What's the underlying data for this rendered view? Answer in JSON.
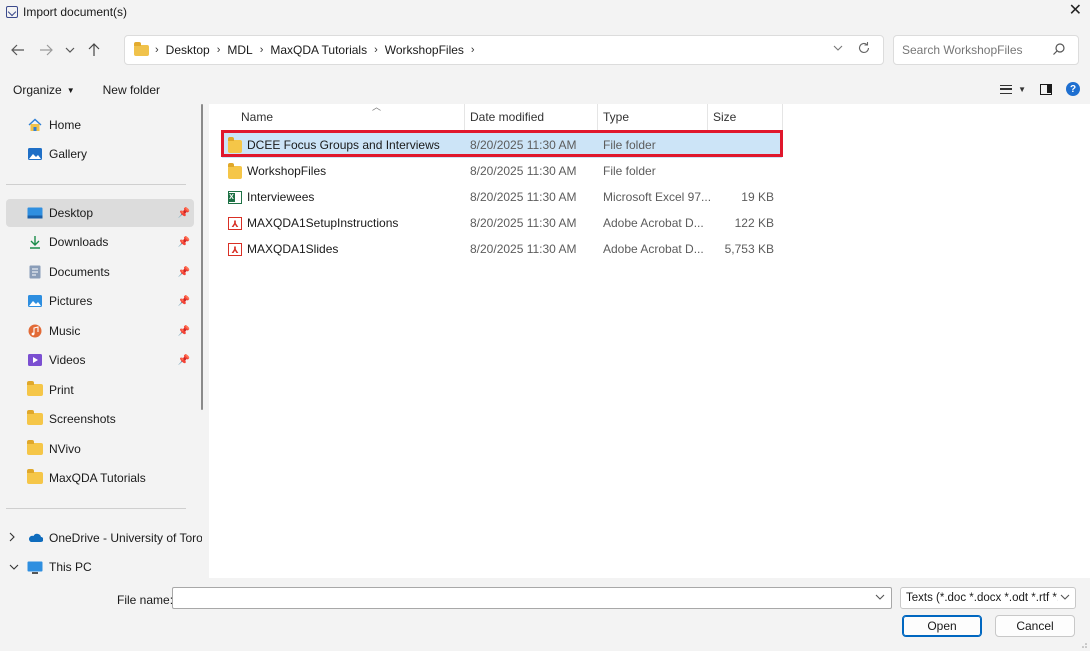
{
  "window": {
    "title": "Import document(s)"
  },
  "address": {
    "crumbs": [
      "Desktop",
      "MDL",
      "MaxQDA Tutorials",
      "WorkshopFiles"
    ],
    "search_placeholder": "Search WorkshopFiles"
  },
  "commands": {
    "organize": "Organize",
    "new_folder": "New folder"
  },
  "sidebar": {
    "items": [
      {
        "label": "Home",
        "icon": "home-icon"
      },
      {
        "label": "Gallery",
        "icon": "gallery-icon"
      },
      {
        "label": "Desktop",
        "icon": "desktop-icon",
        "pinned": true,
        "selected": true
      },
      {
        "label": "Downloads",
        "icon": "download-icon",
        "pinned": true
      },
      {
        "label": "Documents",
        "icon": "documents-icon",
        "pinned": true
      },
      {
        "label": "Pictures",
        "icon": "pictures-icon",
        "pinned": true
      },
      {
        "label": "Music",
        "icon": "music-icon",
        "pinned": true
      },
      {
        "label": "Videos",
        "icon": "videos-icon",
        "pinned": true
      },
      {
        "label": "Print",
        "icon": "folder-icon"
      },
      {
        "label": "Screenshots",
        "icon": "folder-icon"
      },
      {
        "label": "NVivo",
        "icon": "folder-icon"
      },
      {
        "label": "MaxQDA Tutorials",
        "icon": "folder-icon"
      },
      {
        "label": "OneDrive - University of Toron",
        "icon": "onedrive-icon"
      },
      {
        "label": "This PC",
        "icon": "this-pc-icon"
      }
    ]
  },
  "columns": {
    "name": "Name",
    "date": "Date modified",
    "type": "Type",
    "size": "Size"
  },
  "files": [
    {
      "name": "DCEE Focus Groups and Interviews",
      "date": "8/20/2025 11:30 AM",
      "type": "File folder",
      "size": "",
      "icon": "folder-icon",
      "selected": true
    },
    {
      "name": "WorkshopFiles",
      "date": "8/20/2025 11:30 AM",
      "type": "File folder",
      "size": "",
      "icon": "folder-icon"
    },
    {
      "name": "Interviewees",
      "date": "8/20/2025 11:30 AM",
      "type": "Microsoft Excel 97...",
      "size": "19 KB",
      "icon": "excel-icon"
    },
    {
      "name": "MAXQDA1SetupInstructions",
      "date": "8/20/2025 11:30 AM",
      "type": "Adobe Acrobat D...",
      "size": "122 KB",
      "icon": "pdf-icon"
    },
    {
      "name": "MAXQDA1Slides",
      "date": "8/20/2025 11:30 AM",
      "type": "Adobe Acrobat D...",
      "size": "5,753 KB",
      "icon": "pdf-icon"
    }
  ],
  "footer": {
    "file_name_label": "File name:",
    "file_name_value": "",
    "filter": "Texts (*.doc *.docx *.odt *.rtf *.l",
    "open": "Open",
    "cancel": "Cancel"
  },
  "colors": {
    "selection": "#cce4f7",
    "highlight_border": "#e0172c",
    "accent": "#0067c0"
  }
}
